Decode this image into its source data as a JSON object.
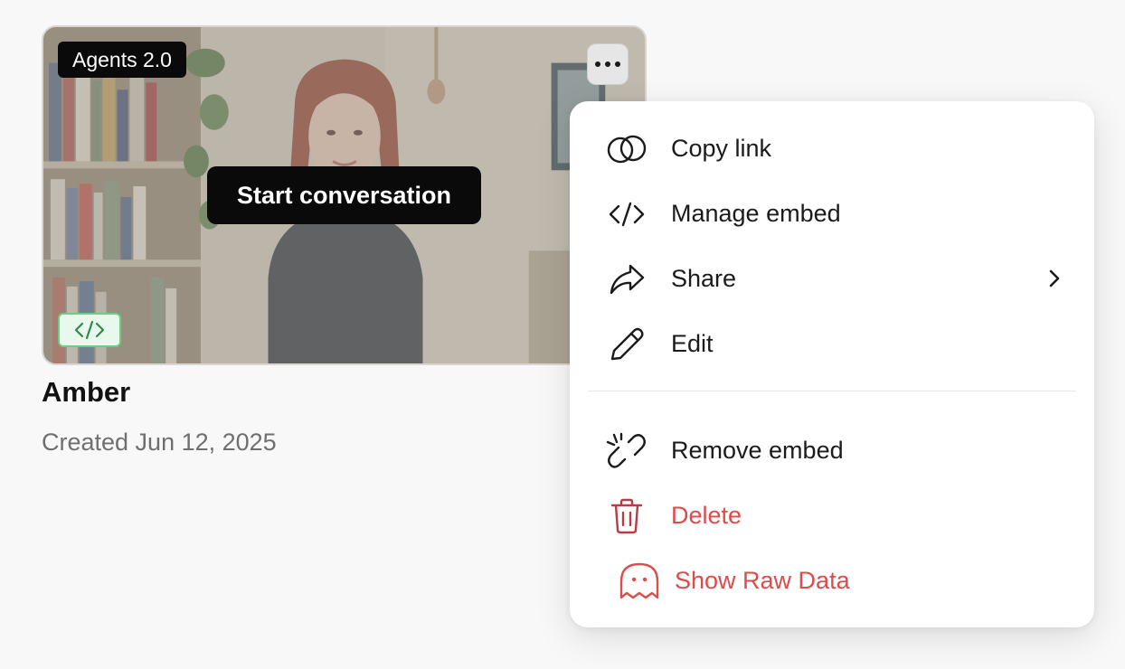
{
  "card": {
    "version_badge": "Agents 2.0",
    "start_button": "Start conversation",
    "name": "Amber",
    "created": "Created Jun 12, 2025",
    "more_icon": "more-horizontal-icon",
    "embed_icon": "code-icon"
  },
  "menu": {
    "items": [
      {
        "label": "Copy link",
        "icon": "link-icon"
      },
      {
        "label": "Manage embed",
        "icon": "code-icon"
      },
      {
        "label": "Share",
        "icon": "share-arrow-icon"
      },
      {
        "label": "Edit",
        "icon": "pencil-icon"
      },
      {
        "label": "Remove embed",
        "icon": "unlink-icon"
      },
      {
        "label": "Delete",
        "icon": "trash-icon"
      },
      {
        "label": "Show Raw Data",
        "icon": "ghost-icon"
      }
    ]
  },
  "colors": {
    "page_background": "#f8f8f8",
    "danger": "#dd4b4b",
    "embed_badge_border": "#6ccd86",
    "embed_badge_fill": "#e9f8ec",
    "dark": "#0a0a0a"
  }
}
